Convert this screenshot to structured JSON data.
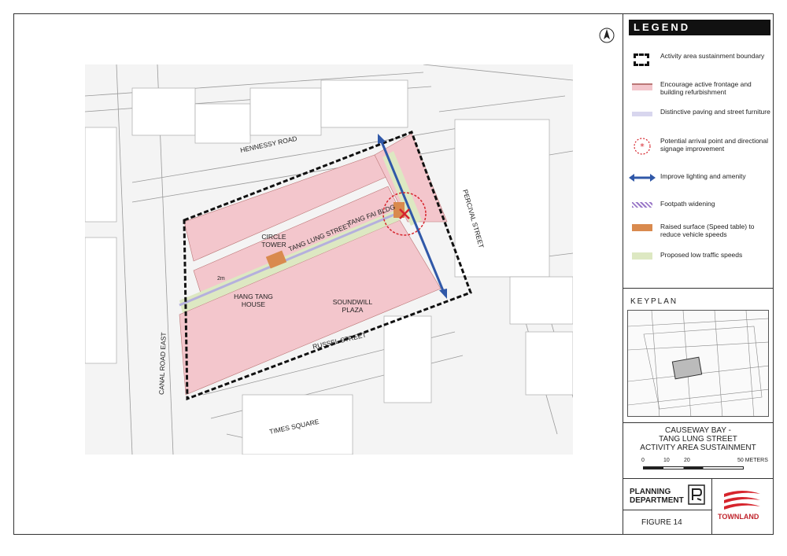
{
  "legend": {
    "title": "LEGEND",
    "items": [
      {
        "label": "Activity area sustainment boundary",
        "icon": "dashed-boundary-icon"
      },
      {
        "label": "Encourage active frontage and building refurbishment",
        "icon": "pink-swatch-icon",
        "color": "#f3c6cc"
      },
      {
        "label": "Distinctive paving and street furniture",
        "icon": "lavender-swatch-icon",
        "color": "#d8d6ee"
      },
      {
        "label": "Potential arrival point and directional signage improvement",
        "icon": "arrival-point-icon",
        "color": "#d6242c"
      },
      {
        "label": "Improve lighting and amenity",
        "icon": "double-arrow-icon",
        "color": "#3058a8"
      },
      {
        "label": "Footpath widening",
        "icon": "hatched-swatch-icon",
        "color": "#9a78c8"
      },
      {
        "label": "Raised surface (Speed table) to reduce vehicle speeds",
        "icon": "orange-swatch-icon",
        "color": "#d98a4e"
      },
      {
        "label": "Proposed low traffic speeds",
        "icon": "green-swatch-icon",
        "color": "#dde8c2"
      }
    ]
  },
  "keyplan": {
    "title": "KEYPLAN"
  },
  "title_block": {
    "line1": "CAUSEWAY BAY -",
    "line2": "TANG LUNG STREET",
    "line3": "ACTIVITY AREA SUSTAINMENT"
  },
  "scale": {
    "ticks": [
      "0",
      "10",
      "20",
      "50 METERS"
    ]
  },
  "department": {
    "line1": "PLANNING",
    "line2": "DEPARTMENT"
  },
  "figure": {
    "label": "FIGURE  14"
  },
  "logo": {
    "text": "TOWNLAND"
  },
  "map": {
    "street_labels": [
      "HENNESSY ROAD",
      "TANG LUNG STREET",
      "RUSSEL STREET",
      "PERCIVAL STREET",
      "CANAL ROAD EAST",
      "TIMES SQUARE"
    ],
    "building_labels": [
      "CIRCLE TOWER",
      "TANG FAI BLDG",
      "HANG TANG HOUSE",
      "SOUNDWILL PLAZA"
    ],
    "dimension": "2m"
  }
}
